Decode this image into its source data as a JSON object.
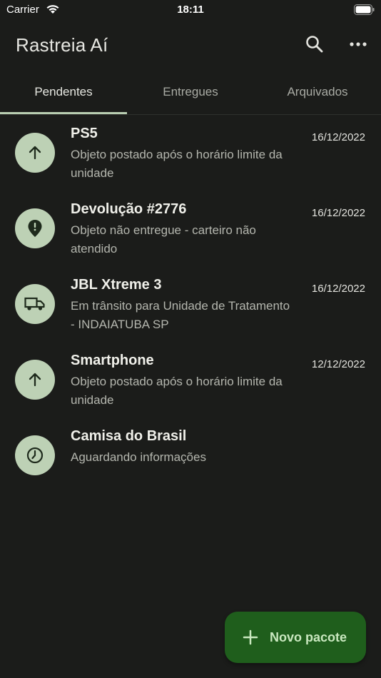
{
  "status_bar": {
    "carrier": "Carrier",
    "time": "18:11",
    "wifi_icon": "wifi-icon",
    "battery_icon": "battery-icon"
  },
  "app_bar": {
    "title": "Rastreia Aí",
    "search_icon": "search-icon",
    "more_icon": "more-horizontal-icon"
  },
  "tabs": [
    {
      "label": "Pendentes",
      "active": true
    },
    {
      "label": "Entregues",
      "active": false
    },
    {
      "label": "Arquivados",
      "active": false
    }
  ],
  "packages": [
    {
      "title": "PS5",
      "subtitle": "Objeto postado após o horário limite da unidade",
      "date": "16/12/2022",
      "icon": "arrow-up-icon"
    },
    {
      "title": "Devolução #2776",
      "subtitle": "Objeto não entregue - carteiro não atendido",
      "date": "16/12/2022",
      "icon": "alert-pin-icon"
    },
    {
      "title": "JBL Xtreme 3",
      "subtitle": "Em trânsito para Unidade de Tratamento - INDAIATUBA SP",
      "date": "16/12/2022",
      "icon": "truck-icon"
    },
    {
      "title": "Smartphone",
      "subtitle": "Objeto postado após o horário limite da unidade",
      "date": "12/12/2022",
      "icon": "arrow-up-icon"
    },
    {
      "title": "Camisa do Brasil",
      "subtitle": "Aguardando informações",
      "date": "",
      "icon": "clock-icon"
    }
  ],
  "fab": {
    "label": "Novo pacote",
    "icon": "plus-icon"
  },
  "colors": {
    "background": "#1b1c1a",
    "avatar": "#bdd1b5",
    "fab": "#1f5e1c",
    "tab_indicator": "#b8cdb1"
  }
}
